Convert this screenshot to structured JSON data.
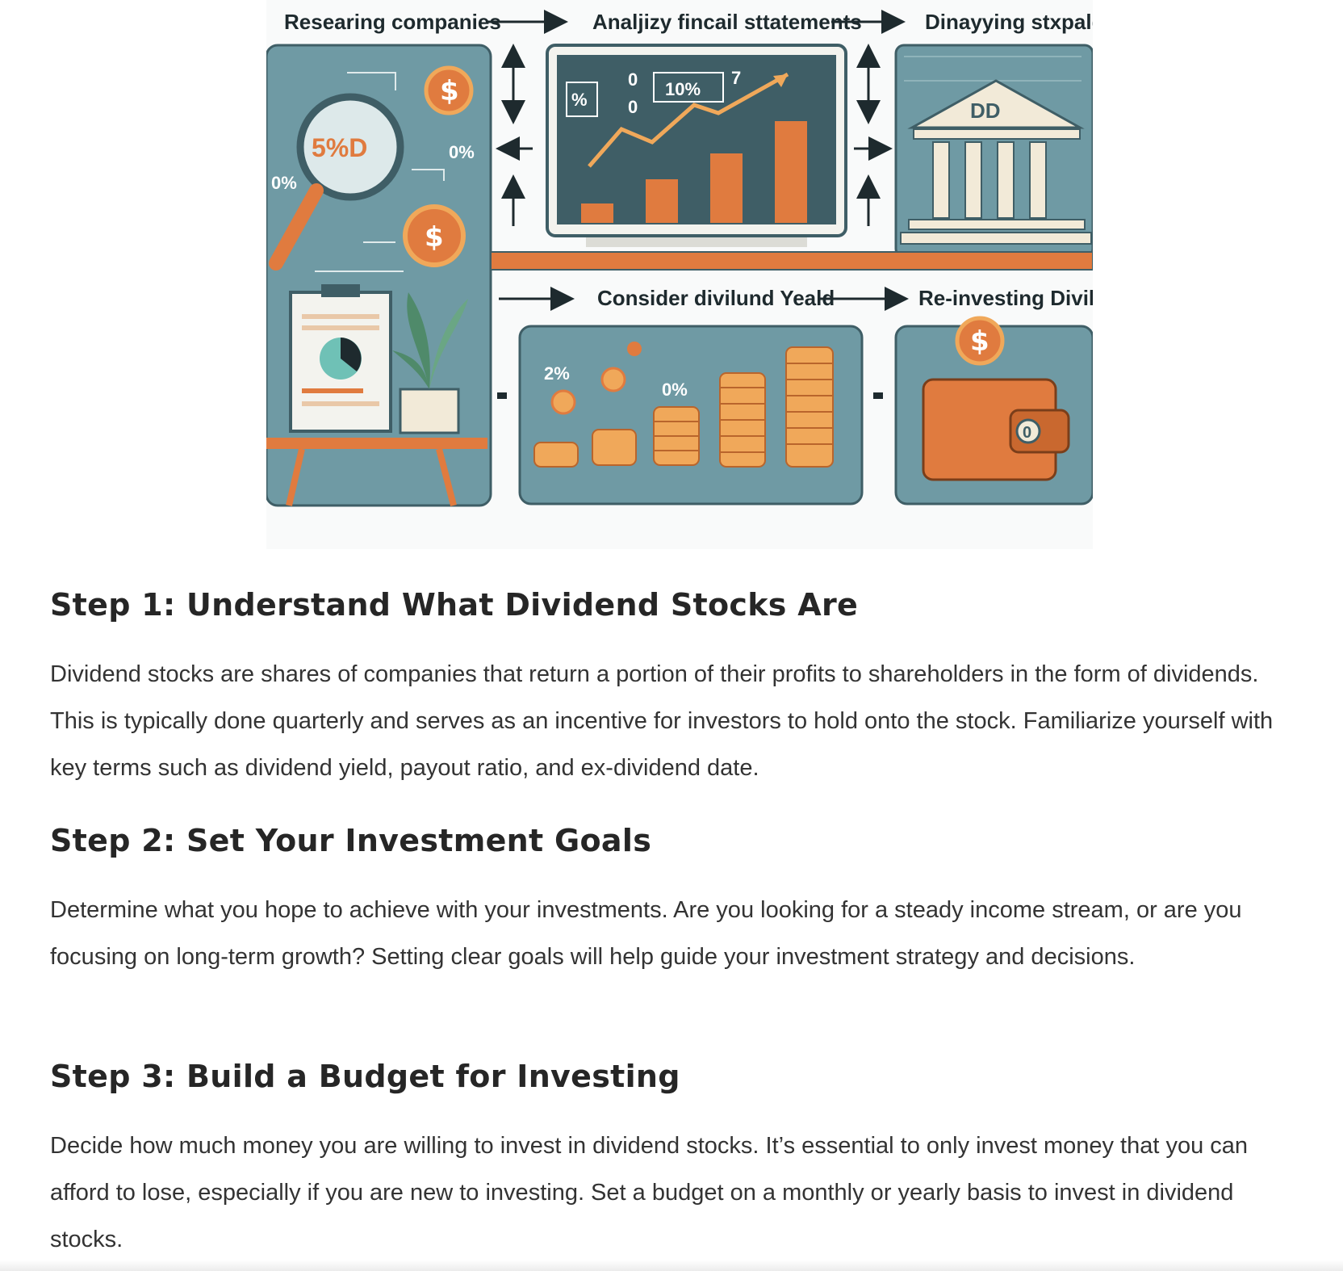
{
  "infographic": {
    "labels": {
      "top_left": "Researing companies",
      "top_mid": "Analjizy fincail sttatements",
      "top_right": "Dinayying stxpald",
      "bottom_mid": "Consider divilund Yeald",
      "bottom_right": "Re-investing Divildin"
    },
    "texts": {
      "magnifier": "5%D",
      "pct_zero": "0%",
      "pct_small": "0%",
      "pct_ten": "10%",
      "pct_box": "%",
      "seven": "7",
      "zero_a": "0",
      "zero_b": "0",
      "bank_sign": "DD",
      "yield_left": "2%",
      "yield_mid": "0%",
      "wallet_clasp": "0",
      "dollar": "$"
    },
    "colors": {
      "teal": "#6f9aa4",
      "dark_teal": "#3f5e66",
      "orange": "#e07b3f",
      "coin": "#f0a85a",
      "cream": "#f2ead8"
    }
  },
  "article": {
    "step1": {
      "heading": "Step 1: Understand What Dividend Stocks Are",
      "body": "Dividend stocks are shares of companies that return a portion of their profits to shareholders in the form of dividends. This is typically done quarterly and serves as an incentive for investors to hold onto the stock. Familiarize yourself with key terms such as dividend yield, payout ratio, and ex-dividend date."
    },
    "step2": {
      "heading": "Step 2: Set Your Investment Goals",
      "body": "Determine what you hope to achieve with your investments. Are you looking for a steady income stream, or are you focusing on long-term growth? Setting clear goals will help guide your investment strategy and decisions."
    },
    "step3": {
      "heading": "Step 3: Build a Budget for Investing",
      "body": "Decide how much money you are willing to invest in dividend stocks. It’s essential to only invest money that you can afford to lose, especially if you are new to investing. Set a budget on a monthly or yearly basis to invest in dividend stocks."
    }
  }
}
